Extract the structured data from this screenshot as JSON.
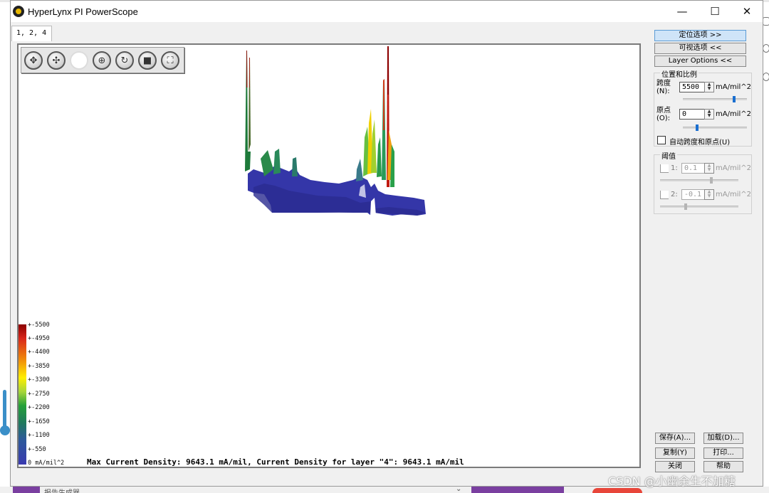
{
  "window": {
    "title": "HyperLynx PI PowerScope",
    "minimize_glyph": "—",
    "maximize_glyph": "☐",
    "close_glyph": "✕"
  },
  "tab": {
    "label": "1, 2, 4"
  },
  "toolbar": {
    "icons": [
      "pan-icon",
      "move-icon",
      "blank-icon",
      "target-icon",
      "rotate-icon",
      "stop-icon",
      "fit-icon"
    ]
  },
  "legend": {
    "labels": [
      "+-5500",
      "+-4950",
      "+-4400",
      "+-3850",
      "+-3300",
      "+-2750",
      "+-2200",
      "+-1650",
      "+-1100",
      "+-550",
      "0 mA/mil^2"
    ]
  },
  "status": {
    "text": "Max Current Density: 9643.1 mA/mil, Current Density for layer \"4\": 9643.1 mA/mil"
  },
  "panel": {
    "positioning_options": "定位选项 >>",
    "visual_options": "可视选项 <<",
    "layer_options": "Layer Options <<",
    "position_scale_group": "位置和比例",
    "span_label_1": "跨度",
    "span_label_2": "(N):",
    "span_value": "5500",
    "span_unit": "mA/mil^2",
    "origin_label_1": "原点",
    "origin_label_2": "(O):",
    "origin_value": "0",
    "origin_unit": "mA/mil^2",
    "auto_span_label": "自动跨度和原点(U)",
    "threshold_group": "阈值",
    "threshold1_label": "1:",
    "threshold1_value": "0.1",
    "threshold1_unit": "mA/mil^2",
    "threshold2_label": "2:",
    "threshold2_value": "-0.1",
    "threshold2_unit": "mA/mil^2"
  },
  "buttons": {
    "save": "保存(A)...",
    "load": "加载(D)...",
    "copy": "复制(Y)",
    "print": "打印...",
    "close": "关闭",
    "help": "帮助"
  },
  "background": {
    "footer_text": "报告生成器",
    "watermark": "CSDN @小幽余生不加糖"
  },
  "colors": {
    "accent_blue": "#1a6fd0",
    "active_button": "#cfe4f8",
    "density_low": "#3a3ab0",
    "density_high": "#8b0000"
  }
}
